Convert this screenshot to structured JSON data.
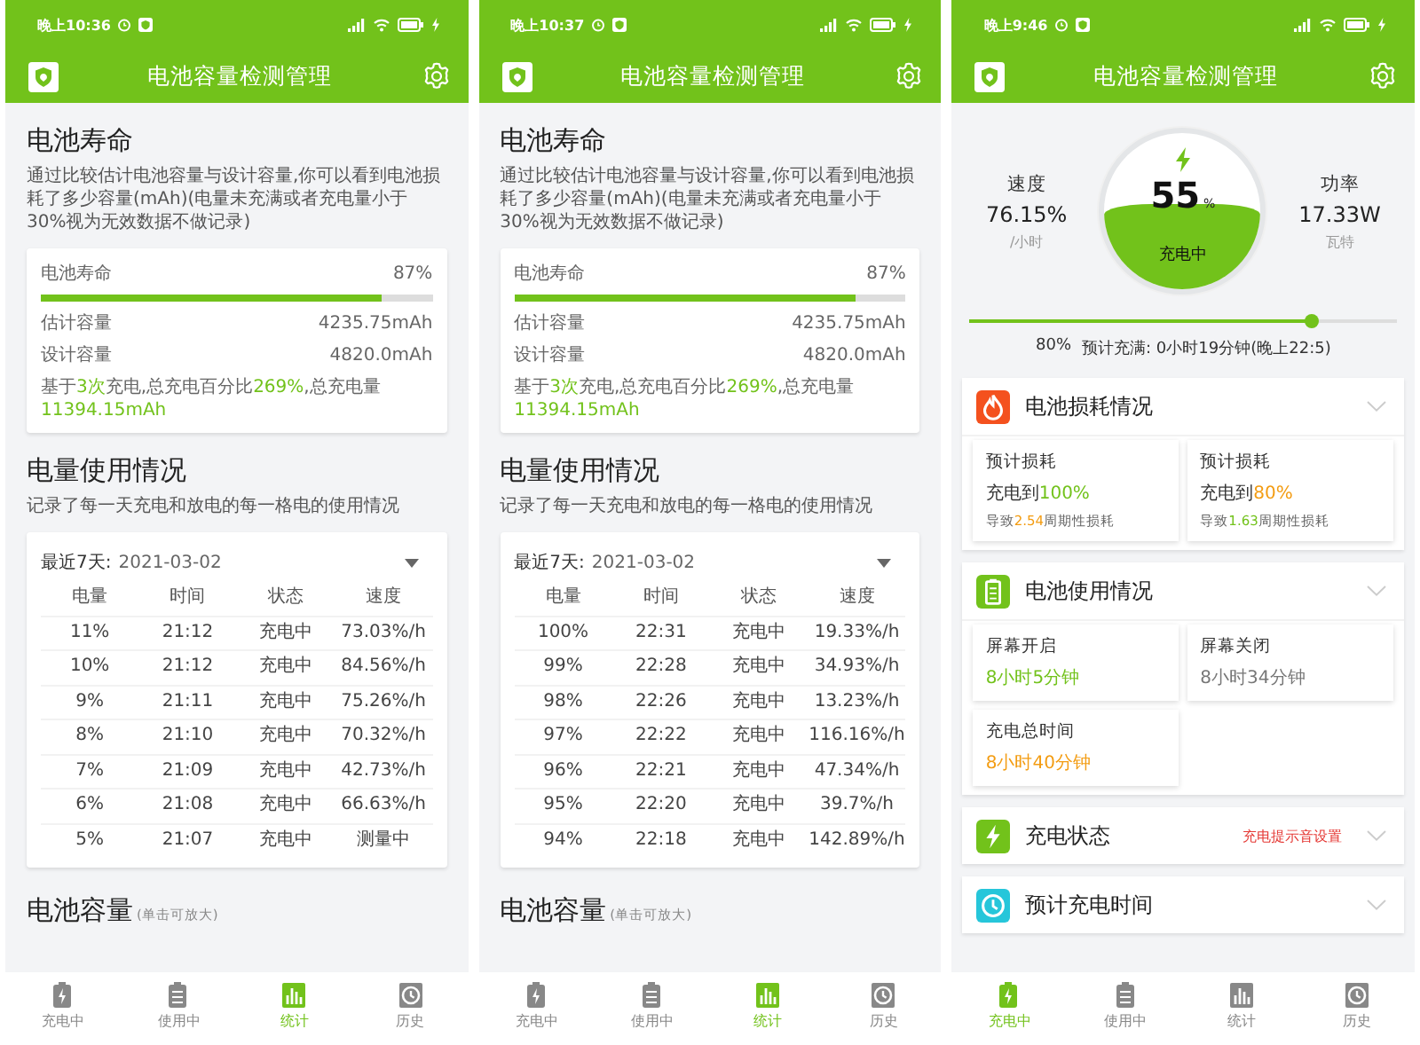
{
  "phones": [
    {
      "kind": "stats",
      "status_bar": {
        "time": "晚上10:36"
      },
      "app_bar": {
        "title": "电池容量检测管理"
      },
      "life": {
        "heading": "电池寿命",
        "description": "通过比较估计电池容量与设计容量,你可以看到电池损耗了多少容量(mAh)(电量未充满或者充电量小于30%视为无效数据不做记录)",
        "label": "电池寿命",
        "value": "87%",
        "level": 0.87,
        "rows": [
          {
            "label": "估计容量",
            "value": "4235.75mAh"
          },
          {
            "label": "设计容量",
            "value": "4820.0mAh"
          }
        ],
        "note": "基于**3次**充电,总充电百分比**269%**,总充电量**11394.15mAh**"
      },
      "usage": {
        "heading": "电量使用情况",
        "description": "记录了每一天充电和放电的每一格电的使用情况",
        "filter_label": "最近7天:",
        "date": "2021-03-02",
        "columns": [
          "电量",
          "时间",
          "状态",
          "速度"
        ],
        "rows": [
          [
            "11%",
            "21:12",
            "充电中",
            "73.03%/h"
          ],
          [
            "10%",
            "21:12",
            "充电中",
            "84.56%/h"
          ],
          [
            "9%",
            "21:11",
            "充电中",
            "75.26%/h"
          ],
          [
            "8%",
            "21:10",
            "充电中",
            "70.32%/h"
          ],
          [
            "7%",
            "21:09",
            "充电中",
            "42.73%/h"
          ],
          [
            "6%",
            "21:08",
            "充电中",
            "66.63%/h"
          ],
          [
            "5%",
            "21:07",
            "充电中",
            "测量中"
          ]
        ]
      },
      "capacity": {
        "heading": "电池容量",
        "hint": "(单击可放大)"
      },
      "nav": [
        {
          "label": "充电中",
          "selected": false
        },
        {
          "label": "使用中",
          "selected": false
        },
        {
          "label": "统计",
          "selected": true
        },
        {
          "label": "历史",
          "selected": false
        }
      ]
    },
    {
      "kind": "stats",
      "status_bar": {
        "time": "晚上10:37"
      },
      "app_bar": {
        "title": "电池容量检测管理"
      },
      "life": {
        "heading": "电池寿命",
        "description": "通过比较估计电池容量与设计容量,你可以看到电池损耗了多少容量(mAh)(电量未充满或者充电量小于30%视为无效数据不做记录)",
        "label": "电池寿命",
        "value": "87%",
        "level": 0.87,
        "rows": [
          {
            "label": "估计容量",
            "value": "4235.75mAh"
          },
          {
            "label": "设计容量",
            "value": "4820.0mAh"
          }
        ],
        "note": "基于**3次**充电,总充电百分比**269%**,总充电量**11394.15mAh**"
      },
      "usage": {
        "heading": "电量使用情况",
        "description": "记录了每一天充电和放电的每一格电的使用情况",
        "filter_label": "最近7天:",
        "date": "2021-03-02",
        "columns": [
          "电量",
          "时间",
          "状态",
          "速度"
        ],
        "rows": [
          [
            "100%",
            "22:31",
            "充电中",
            "19.33%/h"
          ],
          [
            "99%",
            "22:28",
            "充电中",
            "34.93%/h"
          ],
          [
            "98%",
            "22:26",
            "充电中",
            "13.23%/h"
          ],
          [
            "97%",
            "22:22",
            "充电中",
            "116.16%/h"
          ],
          [
            "96%",
            "22:21",
            "充电中",
            "47.34%/h"
          ],
          [
            "95%",
            "22:20",
            "充电中",
            "39.7%/h"
          ],
          [
            "94%",
            "22:18",
            "充电中",
            "142.89%/h"
          ]
        ]
      },
      "capacity": {
        "heading": "电池容量",
        "hint": "(单击可放大)"
      },
      "nav": [
        {
          "label": "充电中",
          "selected": false
        },
        {
          "label": "使用中",
          "selected": false
        },
        {
          "label": "统计",
          "selected": true
        },
        {
          "label": "历史",
          "selected": false
        }
      ]
    },
    {
      "kind": "charging",
      "status_bar": {
        "time": "晚上9:46"
      },
      "app_bar": {
        "title": "电池容量检测管理"
      },
      "gauge": {
        "left": {
          "label": "速度",
          "value": "76.15%",
          "unit": "/小时"
        },
        "percent": "55",
        "percent_unit": "%",
        "state": "充电中",
        "right": {
          "label": "功率",
          "value": "17.33W",
          "unit": "瓦特"
        }
      },
      "slider": {
        "level": 0.8,
        "target": "80%",
        "estimate": "预计充满: 0小时19分钟(晚上22:5)"
      },
      "sections": [
        {
          "color": "#f4511e",
          "title": "电池损耗情况",
          "tiles": [
            {
              "label": "预计损耗",
              "value": "充电到**100%**",
              "color": "#72c21b",
              "note": {
                "text": "导致**2.54**周期性损耗",
                "color": "#f39c12"
              }
            },
            {
              "label": "预计损耗",
              "value": "充电到**80%**",
              "color": "#f39c12",
              "note": {
                "text": "导致**1.63**周期性损耗",
                "color": "#72c21b"
              }
            }
          ]
        },
        {
          "color": "#72c21b",
          "title": "电池使用情况",
          "tiles": [
            {
              "label": "屏幕开启",
              "value": "8小时5分钟",
              "color": "#72c21b"
            },
            {
              "label": "屏幕关闭",
              "value": "8小时34分钟",
              "color": "#777777"
            },
            {
              "label": "充电总时间",
              "value": "8小时40分钟",
              "color": "#f39c12"
            }
          ]
        },
        {
          "color": "#72c21b",
          "title": "充电状态",
          "action": "充电提示音设置"
        },
        {
          "color": "#26c6da",
          "title": "预计充电时间"
        }
      ],
      "nav": [
        {
          "label": "充电中",
          "selected": true
        },
        {
          "label": "使用中",
          "selected": false
        },
        {
          "label": "统计",
          "selected": false
        },
        {
          "label": "历史",
          "selected": false
        }
      ]
    }
  ]
}
